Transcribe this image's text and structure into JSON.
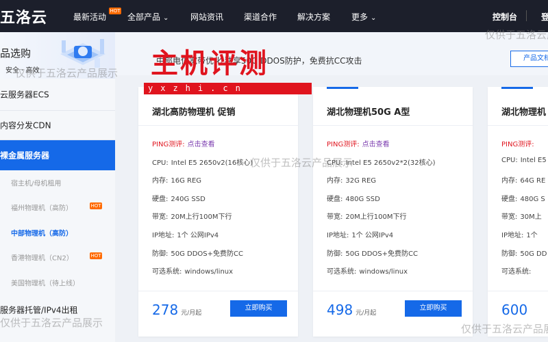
{
  "nav": {
    "logo": "五洛云",
    "items": [
      "最新活动",
      "全部产品",
      "网站资讯",
      "渠道合作",
      "解决方案",
      "更多"
    ],
    "hot_badge": "HOT",
    "console": "控制台",
    "login": "登"
  },
  "sidebar": {
    "title": "品选购",
    "subtitle": "安全  · 高效",
    "items": [
      "云服务器ECS",
      "内容分发CDN",
      "裸金属服务器",
      "服务器托管/IPv4出租"
    ],
    "sub_items": [
      "宿主机/母机租用",
      "福州物理机（高防）",
      "中部物理机（高防）",
      "香港物理机（CN2）",
      "美国物理机（待上线）"
    ],
    "hot_badge": "HOT"
  },
  "banner": {
    "text": "中部电信宽带优化 独享50G DDOS防护，免费抗CC攻击",
    "product_button": "产品文档"
  },
  "watermarks": {
    "big": "主机评测",
    "url": "yxzhi.cn",
    "faint": "仅供于五洛云产品展示"
  },
  "cards": [
    {
      "title": "湖北高防物理机 促销",
      "ping_label": "PING测评:",
      "ping_link": "点击查看",
      "specs": [
        {
          "k": "CPU:",
          "v": "Intel E5 2650v2(16核心)"
        },
        {
          "k": "内存:",
          "v": "16G REG"
        },
        {
          "k": "硬盘:",
          "v": "240G SSD"
        },
        {
          "k": "带宽:",
          "v": "20M上行100M下行"
        },
        {
          "k": "IP地址:",
          "v": "1个 公网IPv4"
        },
        {
          "k": "防御:",
          "v": "50G DDOS+免费防CC"
        },
        {
          "k": "可选系统:",
          "v": "windows/linux"
        }
      ],
      "price": "278",
      "unit": "元/月起",
      "buy": "立即购买"
    },
    {
      "title": "湖北物理机50G A型",
      "ping_label": "PING测评:",
      "ping_link": "点击查看",
      "specs": [
        {
          "k": "CPU:",
          "v": "Intel E5 2650v2*2(32核心)"
        },
        {
          "k": "内存:",
          "v": "32G REG"
        },
        {
          "k": "硬盘:",
          "v": "480G SSD"
        },
        {
          "k": "带宽:",
          "v": "20M上行100M下行"
        },
        {
          "k": "IP地址:",
          "v": "1个 公网IPv4"
        },
        {
          "k": "防御:",
          "v": "50G DDOS+免费防CC"
        },
        {
          "k": "可选系统:",
          "v": "windows/linux"
        }
      ],
      "price": "498",
      "unit": "元/月起",
      "buy": "立即购买"
    },
    {
      "title": "湖北物理机",
      "ping_label": "PING测评:",
      "ping_link": "",
      "specs": [
        {
          "k": "CPU:",
          "v": "Intel E5"
        },
        {
          "k": "内存:",
          "v": "64G RE"
        },
        {
          "k": "硬盘:",
          "v": "480G S"
        },
        {
          "k": "带宽:",
          "v": "30M上"
        },
        {
          "k": "IP地址:",
          "v": "1个"
        },
        {
          "k": "防御:",
          "v": "50G DD"
        },
        {
          "k": "可选系统:",
          "v": ""
        }
      ],
      "price": "600",
      "unit": "",
      "buy": ""
    }
  ],
  "colors": {
    "nav_bg": "#1c1f2b",
    "accent": "#1569e8",
    "hot": "#ff6a00",
    "watermark_red": "#e0141e"
  }
}
